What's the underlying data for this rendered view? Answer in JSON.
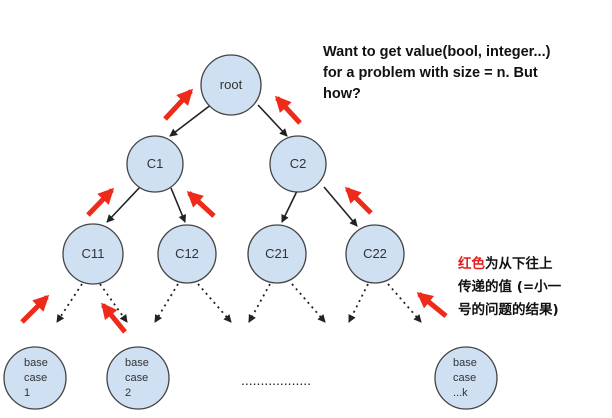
{
  "colors": {
    "node_fill": "#cfe0f3",
    "node_stroke": "#444444",
    "arrow_red": "#ee2a1b",
    "text_dark": "#111111"
  },
  "tree": {
    "root": "root",
    "c1": "C1",
    "c2": "C2",
    "c11": "C11",
    "c12": "C12",
    "c21": "C21",
    "c22": "C22"
  },
  "base_cases": {
    "left": [
      "base",
      "case",
      "1"
    ],
    "middle": [
      "base",
      "case",
      "2"
    ],
    "right": [
      "base",
      "case",
      "...k"
    ]
  },
  "ellipsis": "..................",
  "question": {
    "line1": "Want to get value(bool, integer...)",
    "line2": "for a problem with size = n.  But",
    "line3": "how?"
  },
  "note": {
    "red_word": "红色",
    "line1_rest": "为从下往上",
    "line2": "传递的值 (=小一",
    "line3": "号的问题的结果)"
  }
}
